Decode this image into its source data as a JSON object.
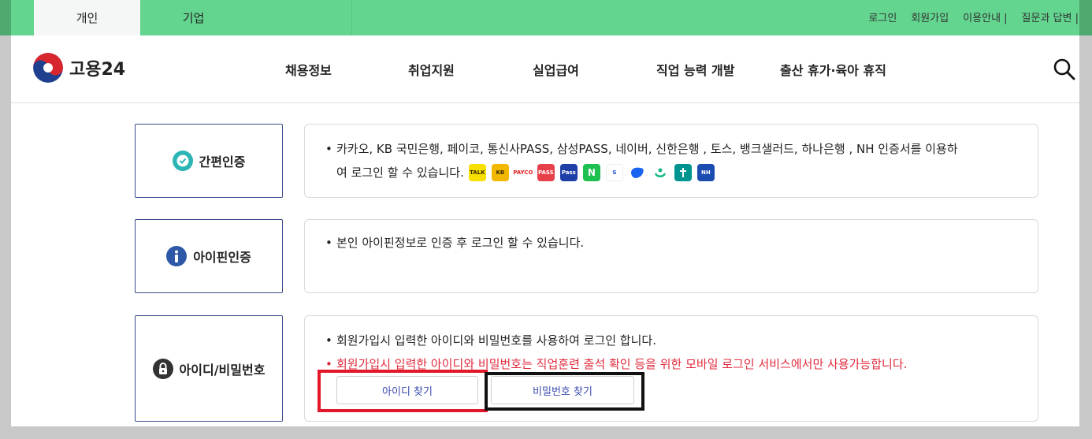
{
  "tabs": {
    "personal": "개인",
    "business": "기업"
  },
  "util_links": [
    "로그인",
    "회원가입",
    "이용안내 |",
    "질문과 답변 |"
  ],
  "logo": {
    "text": "고용24"
  },
  "nav": [
    "채용정보",
    "취업지원",
    "실업급여",
    "직업 능력 개발",
    "출산 휴가·육아 휴직"
  ],
  "sections": {
    "simple": {
      "label": "간편인증",
      "desc_1": "카카오, KB 국민은행, 페이코, 통신사PASS, 삼성PASS, 네이버, 신한은행 , 토스, 뱅크샐러드, 하나은행 , NH 인증서를 이용하",
      "desc_2": "여 로그인 할 수 있습니다.",
      "icons": [
        "TALK",
        "KB",
        "PAYCO",
        "PASS",
        "Pass",
        "N",
        "S",
        "",
        "",
        "",
        "NH"
      ]
    },
    "ipin": {
      "label": "아이핀인증",
      "desc": "본인 아이핀정보로 인증 후 로그인 할 수 있습니다."
    },
    "idpw": {
      "label": "아이디/비밀번호",
      "desc": "회원가입시 입력한 아이디와 비밀번호를 사용하여 로그인 합니다.",
      "warning": "회원가입시 입력한 아이디와 비밀번호는 직업훈련 출석 확인 등을 위한 모바일 로그인 서비스에서만 사용가능합니다.",
      "find_id": "아이디 찾기",
      "find_pw": "비밀번호 찾기"
    }
  },
  "colors": {
    "green": "#63d58f",
    "warning": "#e02a3c",
    "highlight_red": "#e3172a"
  }
}
